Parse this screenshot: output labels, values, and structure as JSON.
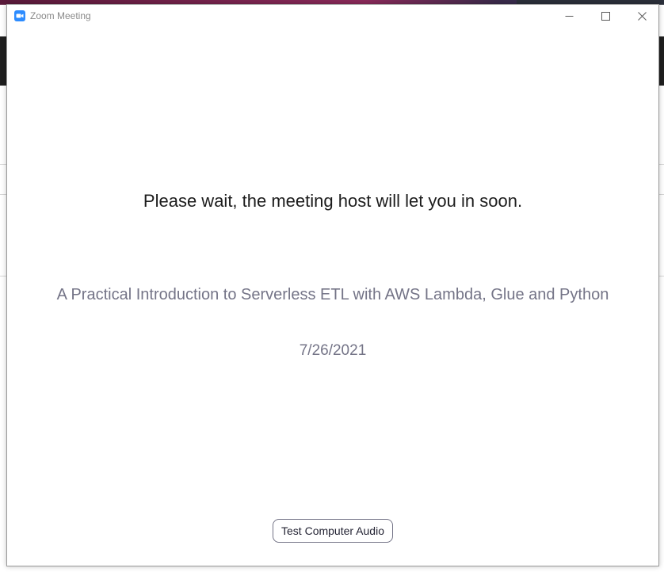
{
  "window": {
    "title": "Zoom Meeting",
    "app_icon": "zoom-camera-icon",
    "controls": [
      "minimize-icon",
      "maximize-icon",
      "close-icon"
    ]
  },
  "waiting_room": {
    "message": "Please wait, the meeting host will let you in soon.",
    "topic": "A Practical Introduction to Serverless ETL with AWS Lambda, Glue and Python",
    "date": "7/26/2021",
    "test_audio_label": "Test Computer Audio"
  },
  "colors": {
    "accent": "#2d8cff",
    "message_text": "#1c1c1c",
    "secondary_text": "#747487"
  }
}
